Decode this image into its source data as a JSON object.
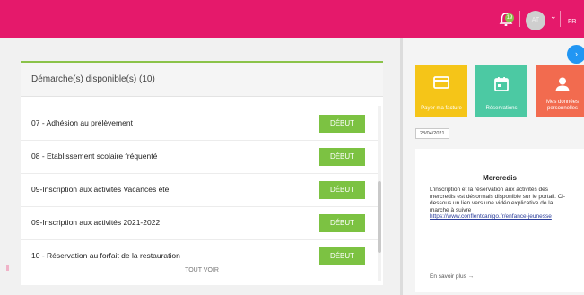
{
  "topbar": {
    "notifications_count": "19",
    "user_initials": "AT",
    "language": "FR"
  },
  "card": {
    "title": "Démarche(s) disponible(s) (10)",
    "rows": [
      {
        "label": "07 - Adhésion au prélèvement",
        "button": "DÉBUT"
      },
      {
        "label": "08 - Etablissement scolaire fréquenté",
        "button": "DÉBUT"
      },
      {
        "label": "09-Inscription aux activités Vacances été",
        "button": "DÉBUT"
      },
      {
        "label": "09-Inscription aux activités 2021-2022",
        "button": "DÉBUT"
      },
      {
        "label": "10 - Réservation au forfait de la restauration",
        "button": "DÉBUT"
      }
    ],
    "see_all": "TOUT VOIR"
  },
  "tiles": [
    {
      "label": "Payer ma facture",
      "color": "#f5c518",
      "icon": "credit-card-icon"
    },
    {
      "label": "Réservations",
      "color": "#4cc9a3",
      "icon": "calendar-icon"
    },
    {
      "label": "Mes données personnelles",
      "color": "#f26b4f",
      "icon": "user-icon"
    }
  ],
  "news": {
    "date": "28/04/2021",
    "title": "Mercredis",
    "body": "L'inscription et la réservation aux activités des mercredis est désormais disponible sur le portail. Ci-dessous un lien vers une vidéo explicative de la marche à suivre",
    "link": "https://www.conflentcanigo.fr/enfance-jeunesse",
    "more": "En savoir plus →"
  },
  "colors": {
    "topbar": "#e5196b",
    "accent_green": "#7cc242",
    "nav_button": "#2196f3"
  }
}
